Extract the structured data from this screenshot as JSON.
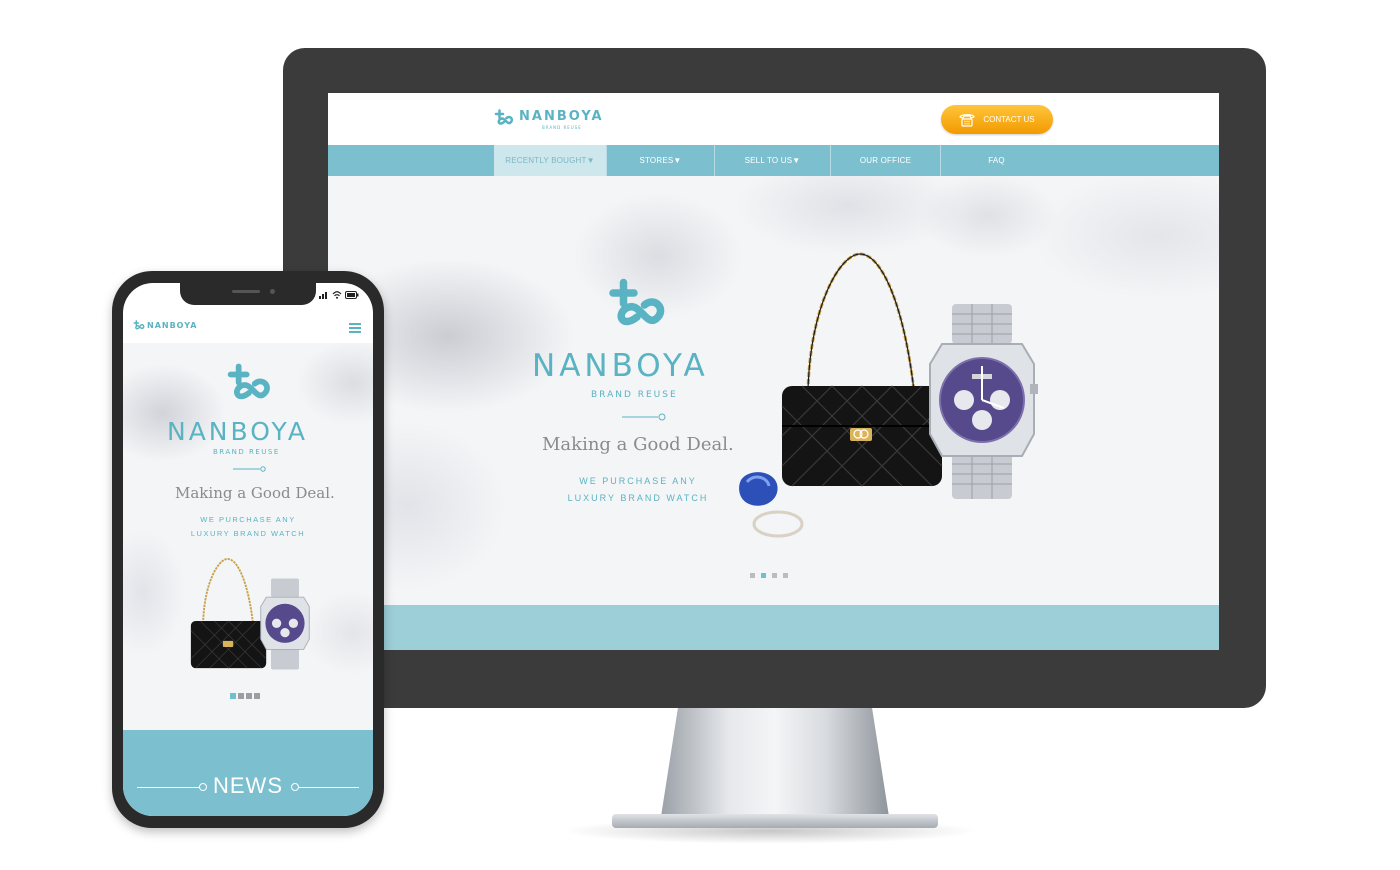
{
  "brand": {
    "name": "NANBOYA",
    "sub": "BRAND REUSE",
    "color": "#5ab3c2"
  },
  "desktop": {
    "header": {
      "contact_label": "CONTACT US",
      "contact_icon": "telephone-icon"
    },
    "nav": {
      "items": [
        {
          "label": "RECENTLY BOUGHT▼",
          "active": true
        },
        {
          "label": "STORES▼",
          "active": false
        },
        {
          "label": "SELL TO US▼",
          "active": false
        },
        {
          "label": "OUR OFFICE",
          "active": false
        },
        {
          "label": "FAQ",
          "active": false
        }
      ]
    },
    "hero": {
      "tagline": "Making a Good Deal.",
      "purchase_line1": "WE PURCHASE ANY",
      "purchase_line2": "LUXURY BRAND WATCH",
      "slide_count": 4,
      "active_slide": 2
    }
  },
  "mobile": {
    "menu_icon": "hamburger-menu-icon",
    "hero": {
      "tagline": "Making a Good Deal.",
      "purchase_line1": "WE PURCHASE ANY",
      "purchase_line2": "LUXURY BRAND WATCH",
      "slide_count": 4,
      "active_slide": 1
    },
    "news_title": "NEWS"
  },
  "colors": {
    "accent_teal": "#7cc0cf",
    "contact_orange": "#f5a400",
    "monitor_bezel": "#3b3b3b"
  }
}
